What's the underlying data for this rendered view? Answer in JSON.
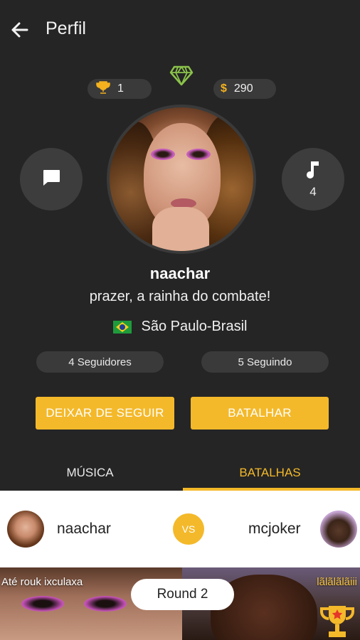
{
  "header": {
    "title": "Perfil",
    "back_icon": "arrow-left-icon"
  },
  "stats": {
    "trophies": "1",
    "coin_symbol": "$",
    "coins": "290"
  },
  "actions": {
    "music_count": "4"
  },
  "profile": {
    "username": "naachar",
    "bio": "prazer, a rainha do combate!",
    "location": "São Paulo-Brasil",
    "followers": "4 Seguidores",
    "following": "5 Seguindo"
  },
  "buttons": {
    "unfollow": "DEIXAR DE SEGUIR",
    "battle": "BATALHAR"
  },
  "tabs": [
    {
      "label": "MÚSICA",
      "active": false
    },
    {
      "label": "BATALHAS",
      "active": true
    }
  ],
  "battle": {
    "player_left": "naachar",
    "vs": "VS",
    "player_right": "mcjoker",
    "left_caption": "Até rouk ixculaxa",
    "right_caption": "lãlãlãlãiii",
    "round": "Round 2"
  },
  "colors": {
    "accent": "#f4b92a",
    "background": "#252525",
    "diamond": "#8bc34a"
  }
}
